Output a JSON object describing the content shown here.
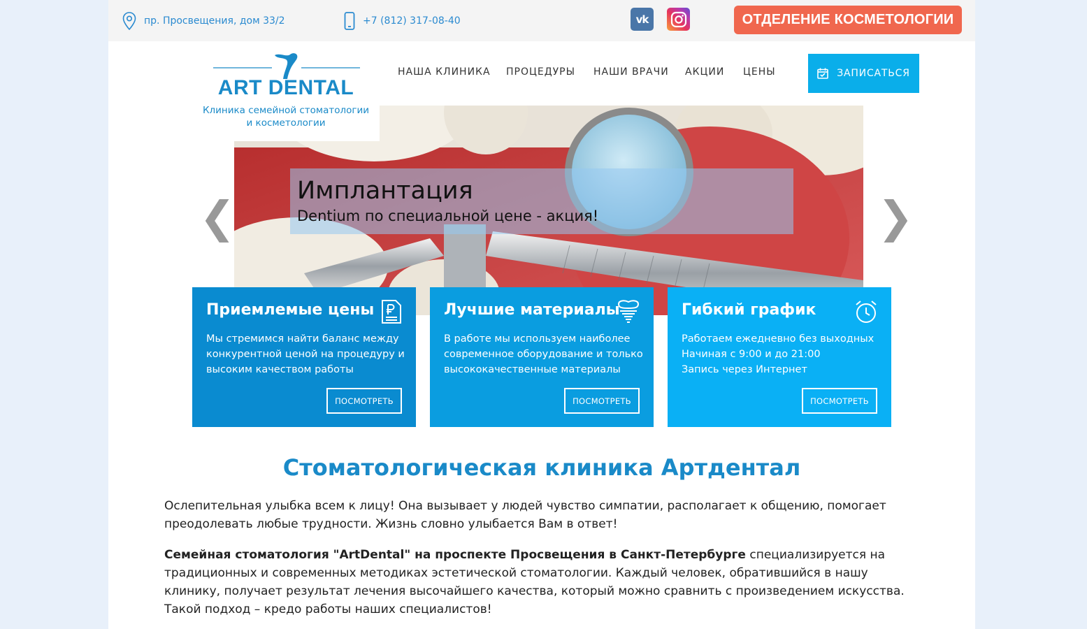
{
  "topbar": {
    "address": "пр. Просвещения, дом 33/2",
    "phone": "+7 (812) 317-08-40",
    "vk_label": "vk",
    "cosmetology_button": "ОТДЕЛЕНИЕ КОСМЕТОЛОГИИ"
  },
  "logo": {
    "title": "ART DENTAL",
    "subtitle_line1": "Клиника семейной стоматологии",
    "subtitle_line2": "и косметологии"
  },
  "nav": {
    "items": [
      "НАША КЛИНИКА",
      "ПРОЦЕДУРЫ",
      "НАШИ ВРАЧИ",
      "АКЦИИ",
      "ЦЕНЫ"
    ],
    "signup_label": "ЗАПИСАТЬСЯ"
  },
  "hero": {
    "title": "Имплантация",
    "subtitle": "Dentium по специальной цене - акция!",
    "prev_arrow": "❮",
    "next_arrow": "❯"
  },
  "cards": [
    {
      "title": "Приемлемые цены",
      "text": "Мы стремимся найти баланс между конкурентной ценой на процедуру и высоким качеством работы",
      "button": "ПОСМОТРЕТЬ",
      "icon": "price-document-icon",
      "color": "#0a8bd0"
    },
    {
      "title": "Лучшие материалы",
      "text": "В работе мы используем наиболее современное оборудование и только высококачественные материалы",
      "button": "ПОСМОТРЕТЬ",
      "icon": "tooth-implant-icon",
      "color": "#0a9de0"
    },
    {
      "title": "Гибкий график",
      "text_line1": "Работаем ежедневно без выходных",
      "text_line2": "Начиная с 9:00 и до 21:00",
      "text_line3": "Запись через Интернет",
      "button": "ПОСМОТРЕТЬ",
      "icon": "alarm-clock-icon",
      "color": "#0ab0f5"
    }
  ],
  "content": {
    "title": "Стоматологическая клиника Артдентал",
    "para1": "Ослепительная улыбка всем к лицу! Она вызывает у людей чувство симпатии, располагает к общению, помогает преодолевать любые трудности. Жизнь словно улыбается Вам в ответ!",
    "para2_bold": "Семейная стоматология \"ArtDental\" на проспекте Просвещения в Санкт-Петербурге",
    "para2_rest": " специализируется на традиционных и современных методиках эстетической стоматологии. Каждый человек, обратившийся в нашу клинику, получает результат лечения высочайшего качества, который можно сравнить с произведением искусства. Такой подход – кредо работы наших специалистов!"
  },
  "colors": {
    "accent": "#1a8ac8",
    "signup": "#0aaeea",
    "cosmetology": "#f0674e"
  }
}
